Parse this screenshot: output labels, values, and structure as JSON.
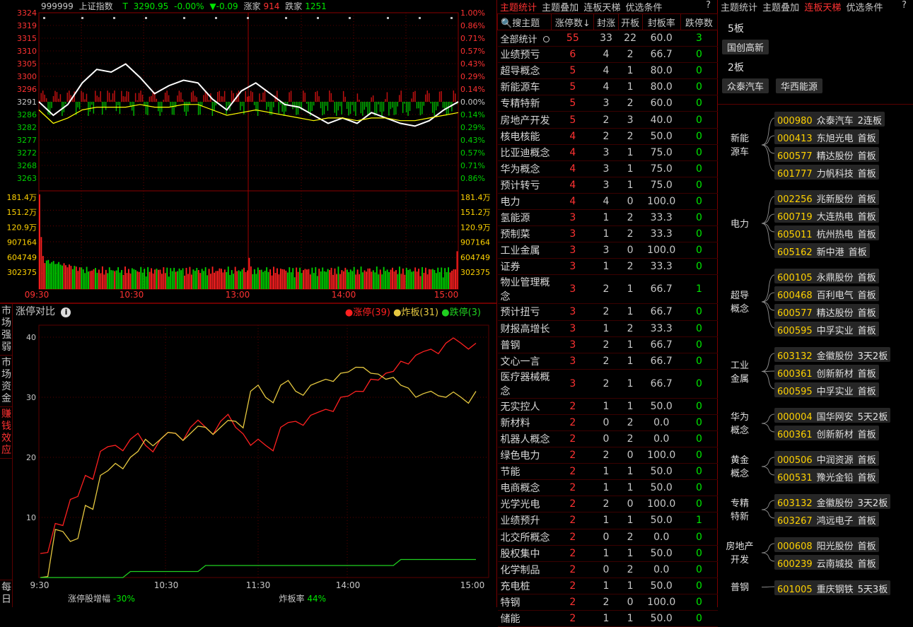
{
  "header": {
    "code": "999999",
    "name": "上证指数",
    "t_label": "T",
    "price": "3290.95",
    "pct": "-0.00%",
    "change": "▼-0.09",
    "up_label": "涨家",
    "up_count": "914",
    "down_label": "跌家",
    "down_count": "1251"
  },
  "main_chart": {
    "price_ticks": [
      "3324",
      "3319",
      "3315",
      "3310",
      "3305",
      "3300",
      "3296",
      "3291",
      "3286",
      "3282",
      "3277",
      "3272",
      "3268",
      "3263"
    ],
    "pct_ticks": [
      "1.00%",
      "0.86%",
      "0.71%",
      "0.57%",
      "0.43%",
      "0.29%",
      "0.14%",
      "0.00%",
      "0.14%",
      "0.29%",
      "0.43%",
      "0.57%",
      "0.71%",
      "0.86%"
    ],
    "vol_ticks": [
      "181.4万",
      "151.2万",
      "120.9万",
      "907164",
      "604749",
      "302375"
    ],
    "time_ticks": [
      "09:30",
      "10:30",
      "13:00",
      "14:00",
      "15:00"
    ]
  },
  "chart_data": [
    {
      "type": "line",
      "title": "",
      "series": [
        {
          "name": "",
          "values": [
            3291,
            3286,
            3290,
            3298,
            3303,
            3302,
            3305,
            3300,
            3294,
            3297,
            3299,
            3298,
            3292,
            3288,
            3295,
            3298,
            3294,
            3290,
            3289,
            3286,
            3283,
            3285,
            3283,
            3287,
            3285,
            3283,
            3282,
            3284,
            3288,
            3291
          ]
        },
        {
          "name": "",
          "values": [
            3288,
            3283,
            3285,
            3288,
            3289,
            3289,
            3289,
            3290,
            3289,
            3289,
            3290,
            3290,
            3288,
            3286,
            3287,
            3288,
            3287,
            3286,
            3285,
            3284,
            3285,
            3285,
            3284,
            3285,
            3285,
            3284,
            3284,
            3285,
            3286,
            3287
          ]
        }
      ],
      "ylim": [
        3258,
        3324
      ]
    },
    {
      "type": "line",
      "title": "涨停对比",
      "x": [
        "9:30",
        "10:30",
        "11:30",
        "14:00",
        "15:00"
      ],
      "series": [
        {
          "name": "涨停(39)",
          "color": "#ff2020",
          "values": [
            4,
            9,
            13,
            17,
            21,
            22,
            23,
            22,
            23,
            24,
            25,
            25,
            26,
            25,
            22,
            22,
            25,
            26,
            27,
            28,
            30,
            31,
            33,
            34,
            36,
            37,
            38,
            39,
            39,
            39
          ]
        },
        {
          "name": "炸板(31)",
          "color": "#e6c840",
          "values": [
            0,
            8,
            6,
            12,
            17,
            19,
            20,
            23,
            23,
            24,
            24,
            25,
            25,
            26,
            31,
            30,
            32,
            31,
            32,
            33,
            34,
            35,
            34,
            33,
            32,
            30,
            31,
            30,
            30,
            31
          ]
        },
        {
          "name": "跌停(3)",
          "color": "#20d020",
          "values": [
            0,
            0,
            0,
            0,
            0,
            0,
            1,
            1,
            1,
            1,
            1,
            2,
            2,
            2,
            2,
            2,
            2,
            2,
            2,
            2,
            2,
            2,
            2,
            2,
            3,
            3,
            3,
            3,
            3,
            3
          ]
        }
      ],
      "ylim": [
        0,
        42
      ],
      "y_ticks": [
        10,
        20,
        30,
        40
      ]
    }
  ],
  "compare": {
    "title": "涨停对比",
    "legend": [
      {
        "label": "涨停(39)",
        "color": "#ff2020"
      },
      {
        "label": "炸板(31)",
        "color": "#e6c840"
      },
      {
        "label": "跌停(3)",
        "color": "#20d020"
      }
    ],
    "side_tabs": [
      "市场强弱",
      "市场资金",
      "赚钱效应",
      "每日"
    ],
    "foot_label1": "涨停股增幅",
    "foot_val1": "-30%",
    "foot_label2": "炸板率",
    "foot_val2": "44%"
  },
  "mid_tabs": [
    "主题统计",
    "主题叠加",
    "连板天梯",
    "优选条件"
  ],
  "right_tabs": [
    "主题统计",
    "主题叠加",
    "连板天梯",
    "优选条件"
  ],
  "table": {
    "headers": [
      "搜主题",
      "涨停数↓",
      "封涨",
      "开板",
      "封板率",
      "跌停数"
    ],
    "rows": [
      [
        "全部统计",
        "55",
        "33",
        "22",
        "60.0",
        "3"
      ],
      [
        "业绩预亏",
        "6",
        "4",
        "2",
        "66.7",
        "0"
      ],
      [
        "超导概念",
        "5",
        "4",
        "1",
        "80.0",
        "0"
      ],
      [
        "新能源车",
        "5",
        "4",
        "1",
        "80.0",
        "0"
      ],
      [
        "专精特新",
        "5",
        "3",
        "2",
        "60.0",
        "0"
      ],
      [
        "房地产开发",
        "5",
        "2",
        "3",
        "40.0",
        "0"
      ],
      [
        "核电核能",
        "4",
        "2",
        "2",
        "50.0",
        "0"
      ],
      [
        "比亚迪概念",
        "4",
        "3",
        "1",
        "75.0",
        "0"
      ],
      [
        "华为概念",
        "4",
        "3",
        "1",
        "75.0",
        "0"
      ],
      [
        "预计转亏",
        "4",
        "3",
        "1",
        "75.0",
        "0"
      ],
      [
        "电力",
        "4",
        "4",
        "0",
        "100.0",
        "0"
      ],
      [
        "氢能源",
        "3",
        "1",
        "2",
        "33.3",
        "0"
      ],
      [
        "预制菜",
        "3",
        "1",
        "2",
        "33.3",
        "0"
      ],
      [
        "工业金属",
        "3",
        "3",
        "0",
        "100.0",
        "0"
      ],
      [
        "证券",
        "3",
        "1",
        "2",
        "33.3",
        "0"
      ],
      [
        "物业管理概念",
        "3",
        "2",
        "1",
        "66.7",
        "1"
      ],
      [
        "预计扭亏",
        "3",
        "2",
        "1",
        "66.7",
        "0"
      ],
      [
        "财报高增长",
        "3",
        "1",
        "2",
        "33.3",
        "0"
      ],
      [
        "普钢",
        "3",
        "2",
        "1",
        "66.7",
        "0"
      ],
      [
        "文心一言",
        "3",
        "2",
        "1",
        "66.7",
        "0"
      ],
      [
        "医疗器械概念",
        "3",
        "2",
        "1",
        "66.7",
        "0"
      ],
      [
        "无实控人",
        "2",
        "1",
        "1",
        "50.0",
        "0"
      ],
      [
        "新材料",
        "2",
        "0",
        "2",
        "0.0",
        "0"
      ],
      [
        "机器人概念",
        "2",
        "0",
        "2",
        "0.0",
        "0"
      ],
      [
        "绿色电力",
        "2",
        "2",
        "0",
        "100.0",
        "0"
      ],
      [
        "节能",
        "2",
        "1",
        "1",
        "50.0",
        "0"
      ],
      [
        "电商概念",
        "2",
        "1",
        "1",
        "50.0",
        "0"
      ],
      [
        "光学光电",
        "2",
        "2",
        "0",
        "100.0",
        "0"
      ],
      [
        "业绩预升",
        "2",
        "1",
        "1",
        "50.0",
        "1"
      ],
      [
        "北交所概念",
        "2",
        "0",
        "2",
        "0.0",
        "0"
      ],
      [
        "股权集中",
        "2",
        "1",
        "1",
        "50.0",
        "0"
      ],
      [
        "化学制品",
        "2",
        "0",
        "2",
        "0.0",
        "0"
      ],
      [
        "充电桩",
        "2",
        "1",
        "1",
        "50.0",
        "0"
      ],
      [
        "特钢",
        "2",
        "2",
        "0",
        "100.0",
        "0"
      ],
      [
        "储能",
        "2",
        "1",
        "1",
        "50.0",
        "0"
      ]
    ]
  },
  "ladder": {
    "levels": [
      {
        "label": "5板",
        "stocks": [
          "国创高新"
        ]
      },
      {
        "label": "2板",
        "stocks": [
          "众泰汽车",
          "华西能源"
        ]
      }
    ]
  },
  "groups": [
    {
      "name": "新能\n源车",
      "stocks": [
        [
          "000980",
          "众泰汽车",
          "2连板"
        ],
        [
          "000413",
          "东旭光电",
          "首板"
        ],
        [
          "600577",
          "精达股份",
          "首板"
        ],
        [
          "601777",
          "力帆科技",
          "首板"
        ]
      ]
    },
    {
      "name": "电力",
      "stocks": [
        [
          "002256",
          "兆新股份",
          "首板"
        ],
        [
          "600719",
          "大连热电",
          "首板"
        ],
        [
          "605011",
          "杭州热电",
          "首板"
        ],
        [
          "605162",
          "新中港",
          "首板"
        ]
      ]
    },
    {
      "name": "超导\n概念",
      "stocks": [
        [
          "600105",
          "永鼎股份",
          "首板"
        ],
        [
          "600468",
          "百利电气",
          "首板"
        ],
        [
          "600577",
          "精达股份",
          "首板"
        ],
        [
          "600595",
          "中孚实业",
          "首板"
        ]
      ]
    },
    {
      "name": "工业\n金属",
      "stocks": [
        [
          "603132",
          "金徽股份",
          "3天2板"
        ],
        [
          "600361",
          "创新新材",
          "首板"
        ],
        [
          "600595",
          "中孚实业",
          "首板"
        ]
      ]
    },
    {
      "name": "华为\n概念",
      "stocks": [
        [
          "000004",
          "国华网安",
          "5天2板"
        ],
        [
          "600361",
          "创新新材",
          "首板"
        ]
      ]
    },
    {
      "name": "黄金\n概念",
      "stocks": [
        [
          "000506",
          "中润资源",
          "首板"
        ],
        [
          "600531",
          "豫光金铅",
          "首板"
        ]
      ]
    },
    {
      "name": "专精\n特新",
      "stocks": [
        [
          "603132",
          "金徽股份",
          "3天2板"
        ],
        [
          "603267",
          "鸿远电子",
          "首板"
        ]
      ]
    },
    {
      "name": "房地产\n开发",
      "stocks": [
        [
          "000608",
          "阳光股份",
          "首板"
        ],
        [
          "600239",
          "云南城投",
          "首板"
        ]
      ]
    },
    {
      "name": "普钢",
      "stocks": [
        [
          "601005",
          "重庆钢铁",
          "5天3板"
        ]
      ]
    }
  ]
}
